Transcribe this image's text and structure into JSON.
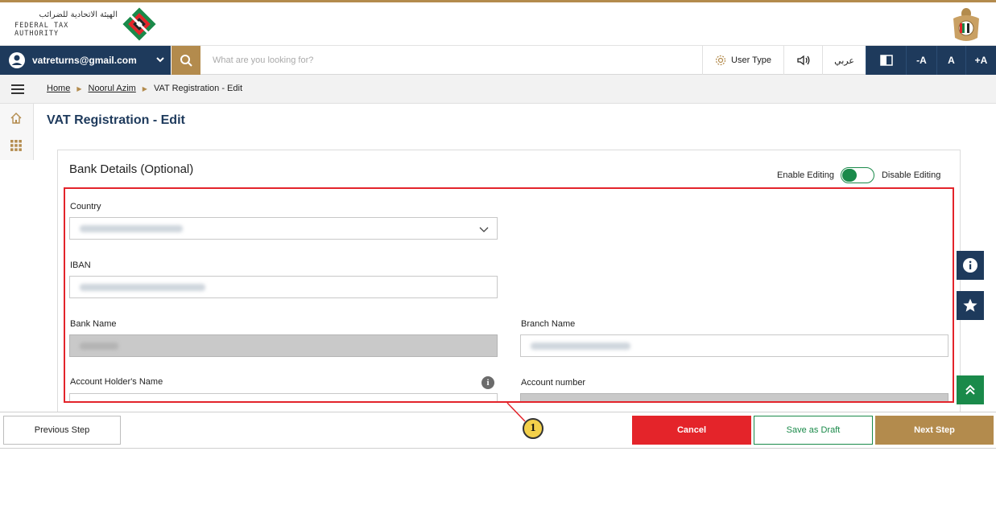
{
  "header": {
    "logo_arabic": "الهيئة الاتحادية للضرائب",
    "logo_english": "FEDERAL TAX AUTHORITY"
  },
  "toolbar": {
    "user_email": "vatreturns@gmail.com",
    "search_placeholder": "What are you looking for?",
    "user_type_label": "User Type",
    "language_label": "عربي",
    "font_decrease": "-A",
    "font_normal": "A",
    "font_increase": "+A"
  },
  "breadcrumb": {
    "home": "Home",
    "user": "Noorul Azim",
    "current": "VAT Registration - Edit"
  },
  "page_title": "VAT Registration - Edit",
  "bank_details": {
    "title": "Bank Details (Optional)",
    "enable_editing": "Enable Editing",
    "disable_editing": "Disable Editing",
    "country_label": "Country",
    "iban_label": "IBAN",
    "bank_name_label": "Bank Name",
    "branch_name_label": "Branch Name",
    "account_holder_label": "Account Holder's Name",
    "account_number_label": "Account number"
  },
  "callout_number": "1",
  "footer": {
    "previous": "Previous Step",
    "cancel": "Cancel",
    "save_draft": "Save as Draft",
    "next": "Next Step"
  },
  "colors": {
    "navy": "#1e3a5c",
    "gold": "#b38b4d",
    "green": "#1a8a4a",
    "red": "#e4242a"
  }
}
